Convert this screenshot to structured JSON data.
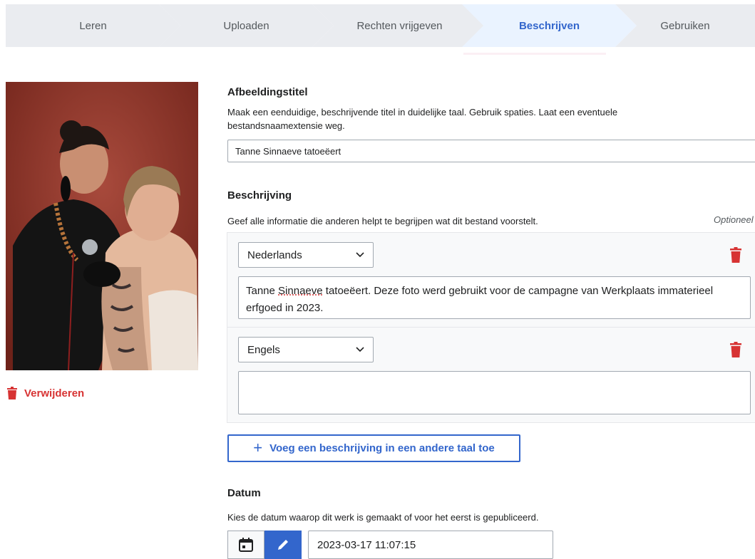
{
  "wizard": {
    "steps": [
      {
        "label": "Leren"
      },
      {
        "label": "Uploaden"
      },
      {
        "label": "Rechten vrijgeven"
      },
      {
        "label": "Beschrijven"
      },
      {
        "label": "Gebruiken"
      }
    ],
    "active_step": "Beschrijven"
  },
  "image": {
    "delete_label": "Verwijderen"
  },
  "title_field": {
    "label": "Afbeeldingstitel",
    "help": "Maak een eenduidige, beschrijvende titel in duidelijke taal. Gebruik spaties. Laat een eventuele bestandsnaamextensie weg.",
    "value": "Tanne Sinnaeve tatoeëert"
  },
  "description_field": {
    "label": "Beschrijving",
    "help": "Geef alle informatie die anderen helpt te begrijpen wat dit bestand voorstelt.",
    "optional_label": "Optioneel",
    "entries": [
      {
        "language": "Nederlands",
        "text_before": "Tanne ",
        "text_flagged": "Sinnaeve",
        "text_after": " tatoeëert. Deze foto werd gebruikt voor de campagne van Werkplaats immaterieel erfgoed in 2023."
      },
      {
        "language": "Engels",
        "text": ""
      }
    ],
    "add_button_label": "Voeg een beschrijving in een andere taal toe"
  },
  "date_field": {
    "label": "Datum",
    "help": "Kies de datum waarop dit werk is gemaakt of voor het eerst is gepubliceerd.",
    "value": "2023-03-17 11:07:15"
  },
  "colors": {
    "accent": "#3366cc",
    "destructive": "#d73333",
    "step_bg": "#eaecf0",
    "step_active_bg": "#eaf3ff"
  },
  "icons": {
    "delete": "trash-icon",
    "calendar": "calendar-icon",
    "edit": "pencil-icon",
    "dropdown": "chevron-down-icon",
    "add": "plus-icon"
  }
}
